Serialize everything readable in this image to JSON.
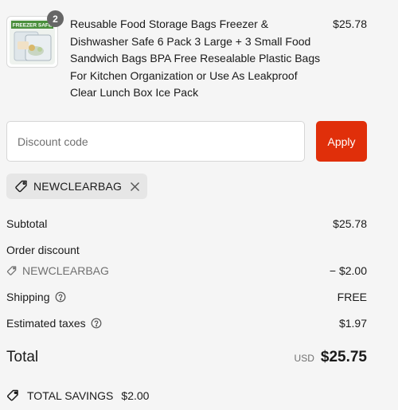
{
  "product": {
    "image_icon": "product-thumbnail",
    "image_text": "FREEZER SAFE",
    "quantity": "2",
    "title": "Reusable Food Storage Bags Freezer & Dishwasher Safe 6 Pack 3 Large + 3 Small Food Sandwich Bags BPA Free Resealable Plastic Bags For Kitchen Organization or Use As Leakproof Clear Lunch Box Ice Pack",
    "price": "$25.78"
  },
  "discount": {
    "placeholder": "Discount code",
    "value": "",
    "apply_label": "Apply",
    "applied_code": "NEWCLEARBAG"
  },
  "summary": {
    "subtotal_label": "Subtotal",
    "subtotal_value": "$25.78",
    "order_discount_label": "Order discount",
    "discount_code": "NEWCLEARBAG",
    "discount_value": "− $2.00",
    "shipping_label": "Shipping",
    "shipping_value": "FREE",
    "taxes_label": "Estimated taxes",
    "taxes_value": "$1.97"
  },
  "total": {
    "label": "Total",
    "currency": "USD",
    "amount": "$25.75"
  },
  "savings": {
    "label": "TOTAL SAVINGS",
    "value": "$2.00"
  },
  "colors": {
    "accent": "#e02f0a",
    "background": "#f5f5f5",
    "muted_text": "#707070"
  }
}
